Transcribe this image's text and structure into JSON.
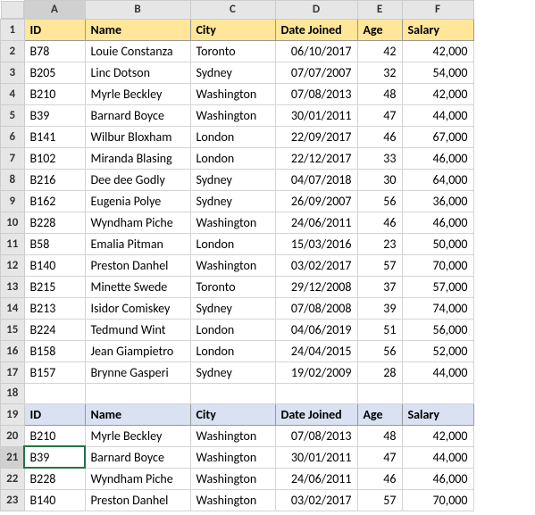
{
  "columns": [
    "A",
    "B",
    "C",
    "D",
    "E",
    "F"
  ],
  "rows": [
    "1",
    "2",
    "3",
    "4",
    "5",
    "6",
    "7",
    "8",
    "9",
    "10",
    "11",
    "12",
    "13",
    "14",
    "15",
    "16",
    "17",
    "18",
    "19",
    "20",
    "21",
    "22",
    "23"
  ],
  "active_row": "21",
  "active_col": "A",
  "headers": {
    "id": "ID",
    "name": "Name",
    "city": "City",
    "date": "Date Joined",
    "age": "Age",
    "salary": "Salary"
  },
  "data1": [
    {
      "id": "B78",
      "name": "Louie Constanza",
      "city": "Toronto",
      "date": "06/10/2017",
      "age": "42",
      "salary": "42,000"
    },
    {
      "id": "B205",
      "name": "Linc Dotson",
      "city": "Sydney",
      "date": "07/07/2007",
      "age": "32",
      "salary": "54,000"
    },
    {
      "id": "B210",
      "name": "Myrle Beckley",
      "city": "Washington",
      "date": "07/08/2013",
      "age": "48",
      "salary": "42,000"
    },
    {
      "id": "B39",
      "name": "Barnard Boyce",
      "city": "Washington",
      "date": "30/01/2011",
      "age": "47",
      "salary": "44,000"
    },
    {
      "id": "B141",
      "name": "Wilbur Bloxham",
      "city": "London",
      "date": "22/09/2017",
      "age": "46",
      "salary": "67,000"
    },
    {
      "id": "B102",
      "name": "Miranda Blasing",
      "city": "London",
      "date": "22/12/2017",
      "age": "33",
      "salary": "46,000"
    },
    {
      "id": "B216",
      "name": "Dee dee Godly",
      "city": "Sydney",
      "date": "04/07/2018",
      "age": "30",
      "salary": "64,000"
    },
    {
      "id": "B162",
      "name": "Eugenia Polye",
      "city": "Sydney",
      "date": "26/09/2007",
      "age": "56",
      "salary": "36,000"
    },
    {
      "id": "B228",
      "name": "Wyndham Piche",
      "city": "Washington",
      "date": "24/06/2011",
      "age": "46",
      "salary": "46,000"
    },
    {
      "id": "B58",
      "name": "Emalia Pitman",
      "city": "London",
      "date": "15/03/2016",
      "age": "23",
      "salary": "50,000"
    },
    {
      "id": "B140",
      "name": "Preston Danhel",
      "city": "Washington",
      "date": "03/02/2017",
      "age": "57",
      "salary": "70,000"
    },
    {
      "id": "B215",
      "name": "Minette Swede",
      "city": "Toronto",
      "date": "29/12/2008",
      "age": "37",
      "salary": "57,000"
    },
    {
      "id": "B213",
      "name": "Isidor Comiskey",
      "city": "Sydney",
      "date": "07/08/2008",
      "age": "39",
      "salary": "74,000"
    },
    {
      "id": "B224",
      "name": "Tedmund Wint",
      "city": "London",
      "date": "04/06/2019",
      "age": "51",
      "salary": "56,000"
    },
    {
      "id": "B158",
      "name": "Jean Giampietro",
      "city": "London",
      "date": "24/04/2015",
      "age": "56",
      "salary": "52,000"
    },
    {
      "id": "B157",
      "name": "Brynne Gasperi",
      "city": "Sydney",
      "date": "19/02/2009",
      "age": "28",
      "salary": "44,000"
    }
  ],
  "data2": [
    {
      "id": "B210",
      "name": "Myrle Beckley",
      "city": "Washington",
      "date": "07/08/2013",
      "age": "48",
      "salary": "42,000"
    },
    {
      "id": "B39",
      "name": "Barnard Boyce",
      "city": "Washington",
      "date": "30/01/2011",
      "age": "47",
      "salary": "44,000"
    },
    {
      "id": "B228",
      "name": "Wyndham Piche",
      "city": "Washington",
      "date": "24/06/2011",
      "age": "46",
      "salary": "46,000"
    },
    {
      "id": "B140",
      "name": "Preston Danhel",
      "city": "Washington",
      "date": "03/02/2017",
      "age": "57",
      "salary": "70,000"
    }
  ]
}
